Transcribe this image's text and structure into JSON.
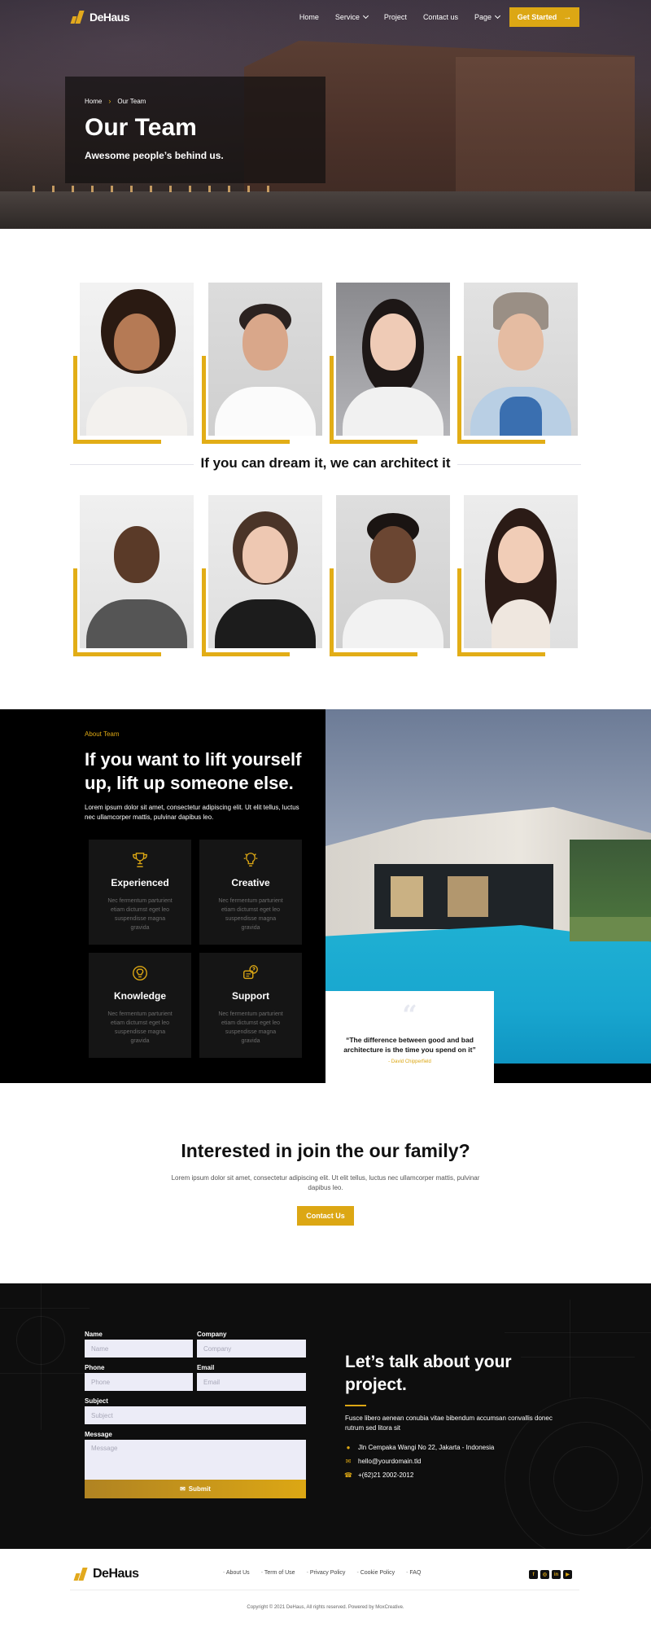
{
  "brand": {
    "name": "DeHaus",
    "accent": "#dca714"
  },
  "nav": {
    "items": [
      {
        "label": "Home",
        "dropdown": false
      },
      {
        "label": "Service",
        "dropdown": true
      },
      {
        "label": "Project",
        "dropdown": false
      },
      {
        "label": "Contact us",
        "dropdown": false
      },
      {
        "label": "Page",
        "dropdown": true
      }
    ],
    "cta_label": "Get Started",
    "cta_icon": "arrow-right-icon"
  },
  "hero": {
    "breadcrumb": [
      "Home",
      "Our Team"
    ],
    "title": "Our Team",
    "subtitle": "Awesome people’s behind us."
  },
  "team": {
    "tagline": "If you can dream it, we can architect it"
  },
  "about": {
    "label": "About Team",
    "title": "If you want to lift yourself up, lift up someone else.",
    "text": "Lorem ipsum dolor sit amet, consectetur adipiscing elit. Ut elit tellus, luctus nec ullamcorper mattis, pulvinar dapibus leo.",
    "features": [
      {
        "title": "Experienced",
        "text": "Nec fermentum parturient etiam dictumst eget leo suspendisse magna gravida",
        "icon": "trophy-icon"
      },
      {
        "title": "Creative",
        "text": "Nec fermentum parturient etiam dictumst eget leo suspendisse magna gravida",
        "icon": "lightbulb-icon"
      },
      {
        "title": "Knowledge",
        "text": "Nec fermentum parturient etiam dictumst eget leo suspendisse magna gravida",
        "icon": "brain-icon"
      },
      {
        "title": "Support",
        "text": "Nec fermentum parturient etiam dictumst eget leo suspendisse magna gravida",
        "icon": "support-chat-icon"
      }
    ],
    "quote": {
      "mark": "“",
      "text": "“The difference between good and bad architecture is the time you spend on it”",
      "author": "- David Chipperfield"
    }
  },
  "cta": {
    "title": "Interested in join the our family?",
    "text": "Lorem ipsum dolor sit amet, consectetur adipiscing elit. Ut elit tellus, luctus nec ullamcorper mattis, pulvinar dapibus leo.",
    "button": "Contact Us"
  },
  "contact_form": {
    "name_label": "Name",
    "name_placeholder": "Name",
    "company_label": "Company",
    "company_placeholder": "Company",
    "phone_label": "Phone",
    "phone_placeholder": "Phone",
    "email_label": "Email",
    "email_placeholder": "Email",
    "subject_label": "Subject",
    "subject_placeholder": "Subject",
    "message_label": "Message",
    "message_placeholder": "Message",
    "submit_label": "Submit"
  },
  "talk": {
    "title": "Let’s talk about your project.",
    "text": "Fusce libero aenean conubia vitae bibendum accumsan convallis donec rutrum sed litora sit",
    "address": "Jln Cempaka Wangi No 22, Jakarta - Indonesia",
    "email": "hello@yourdomain.tld",
    "phone": "+(62)21 2002-2012"
  },
  "footer": {
    "links": [
      "About Us",
      "Term of Use",
      "Privacy Policy",
      "Cookie Policy",
      "FAQ"
    ],
    "socials": [
      {
        "icon": "facebook-icon",
        "glyph": "f"
      },
      {
        "icon": "instagram-icon",
        "glyph": "◎"
      },
      {
        "icon": "linkedin-icon",
        "glyph": "in"
      },
      {
        "icon": "youtube-icon",
        "glyph": "▶"
      }
    ],
    "copyright": "Copyright © 2021 DeHaus, All rights reserved. Powered by MoxCreative."
  }
}
